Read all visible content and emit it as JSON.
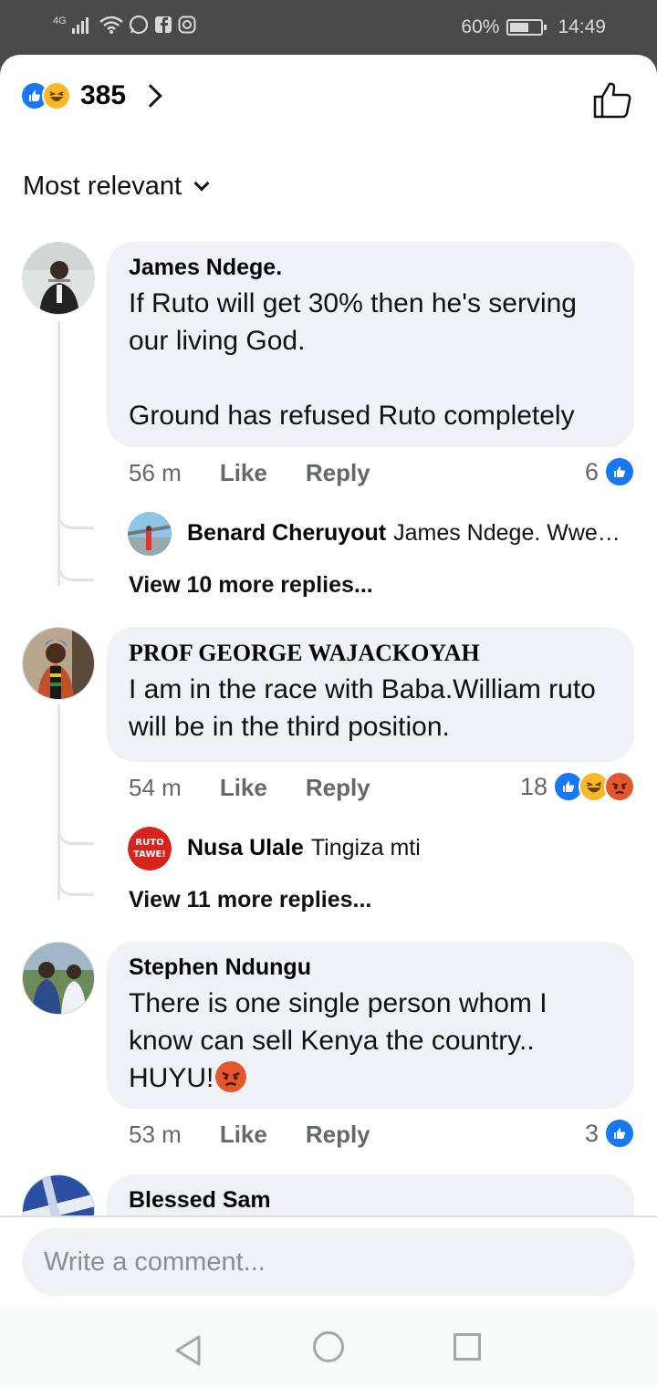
{
  "status_bar": {
    "network": "4G",
    "battery": "60%",
    "battery_level": 0.6,
    "time": "14:49",
    "icons": [
      "signal-icon",
      "wifi-icon",
      "whatsapp-icon",
      "facebook-icon",
      "instagram-icon"
    ]
  },
  "reactions_header": {
    "count": "385",
    "icons": [
      "like-reaction-icon",
      "haha-reaction-icon"
    ]
  },
  "sort": {
    "label": "Most relevant"
  },
  "comments": [
    {
      "author": "James Ndege.",
      "text": "If Ruto will get 30% then he's serving our living God.\n\nGround has refused Ruto completely",
      "time": "56 m",
      "like": "Like",
      "reply": "Reply",
      "reaction_count": "6",
      "reply_preview": {
        "author": "Benard Cheruyout",
        "text": "James Ndege. Wwe…"
      },
      "more_replies": "View 10 more replies..."
    },
    {
      "author": "PROF GEORGE WAJACKOYAH",
      "text": "I am in the race with Baba.William ruto will be in the third position.",
      "time": "54 m",
      "like": "Like",
      "reply": "Reply",
      "reaction_count": "18",
      "reply_preview": {
        "author": "Nusa Ulale",
        "text": "Tingiza mti",
        "avatar_text": "RUTO TAWE!"
      },
      "more_replies": "View 11 more replies..."
    },
    {
      "author": "Stephen Ndungu",
      "text": "There is one single person whom I know can sell Kenya the country.. HUYU!",
      "time": "53 m",
      "like": "Like",
      "reply": "Reply",
      "reaction_count": "3"
    },
    {
      "author": "Blessed Sam"
    }
  ],
  "composer": {
    "placeholder": "Write a comment..."
  },
  "colors": {
    "accent": "#1877f2",
    "bubble": "#eff1f4",
    "muted": "#65676b"
  }
}
